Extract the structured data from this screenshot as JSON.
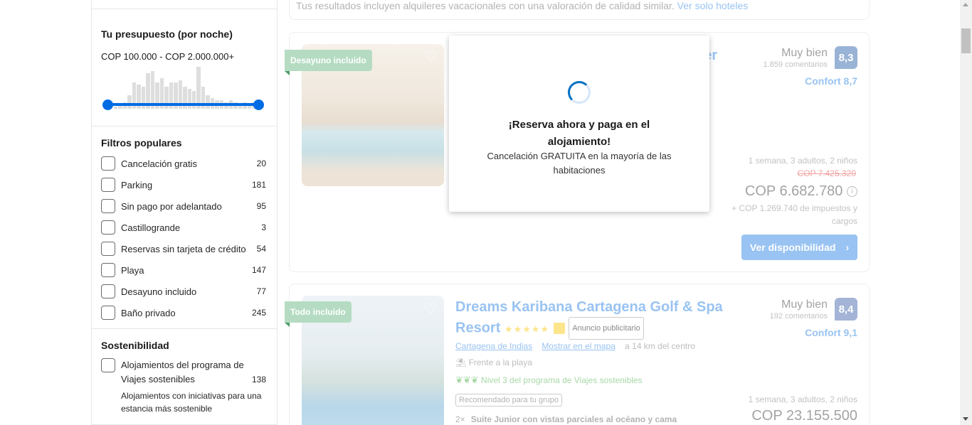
{
  "budget": {
    "title": "Tu presupuesto (por noche)",
    "range": "COP 100.000 - COP 2.000.000+",
    "histogram": [
      0.05,
      0.1,
      0.15,
      0.3,
      0.6,
      0.55,
      0.5,
      0.8,
      0.85,
      0.6,
      0.7,
      0.5,
      0.6,
      0.6,
      0.65,
      0.5,
      0.45,
      0.4,
      0.95,
      0.5,
      0.3,
      0.25,
      0.2,
      0.2,
      0.15,
      0.2,
      0.15,
      0.1,
      0.15,
      0.1,
      0.15,
      0.1
    ]
  },
  "popular": {
    "title": "Filtros populares",
    "filters": [
      {
        "label": "Cancelación gratis",
        "count": "20"
      },
      {
        "label": "Parking",
        "count": "181"
      },
      {
        "label": "Sin pago por adelantado",
        "count": "95"
      },
      {
        "label": "Castillogrande",
        "count": "3"
      },
      {
        "label": "Reservas sin tarjeta de crédito",
        "count": "54"
      },
      {
        "label": "Playa",
        "count": "147"
      },
      {
        "label": "Desayuno incluido",
        "count": "77"
      },
      {
        "label": "Baño privado",
        "count": "245"
      }
    ]
  },
  "sustainability": {
    "title": "Sostenibilidad",
    "label": "Alojamientos del programa de Viajes sostenibles",
    "count": "138",
    "description": "Alojamientos con iniciativas para una estancia más sostenible"
  },
  "topnote": {
    "text": "Tus resultados incluyen alquileres vacacionales con una valoración de calidad similar.",
    "link": "Ver solo hoteles"
  },
  "card1": {
    "ribbon": "Desayuno incluido",
    "name_fragment": "ber",
    "rating_text": "Muy bien",
    "reviews": "1.859 comentarios",
    "score": "8,3",
    "comfort": "Confort 8,7",
    "stay": "1 semana, 3 adultos, 2 niños",
    "old_price": "COP 7.425.320",
    "price": "COP 6.682.780",
    "taxes": "+ COP 1.269.740 de impuestos y cargos",
    "button": "Ver disponibilidad"
  },
  "card2": {
    "ribbon": "Todo incluido",
    "name": "Dreams Karibana Cartagena Golf & Spa Resort",
    "ad": "Anuncio publicitario",
    "rating_text": "Muy bien",
    "reviews": "192 comentarios",
    "score": "8,4",
    "comfort": "Confort 9,1",
    "location_link": "Cartagena de Indias",
    "map_link": "Mostrar en el mapa",
    "distance": "a 14 km del centro",
    "beach": "Frente a la playa",
    "sustain_level": "Nivel 3 del programa de Viajes sostenibles",
    "group_tag": "Recomendado para tu grupo",
    "room_qty": "2×",
    "room": "Suite Junior con vistas parciales al océano y cama",
    "stay": "1 semana, 3 adultos, 2 niños",
    "price": "COP 23.155.500"
  },
  "modal": {
    "title": "¡Reserva ahora y paga en el alojamiento!",
    "text": "Cancelación GRATUITA en la mayoría de las habitaciones"
  }
}
